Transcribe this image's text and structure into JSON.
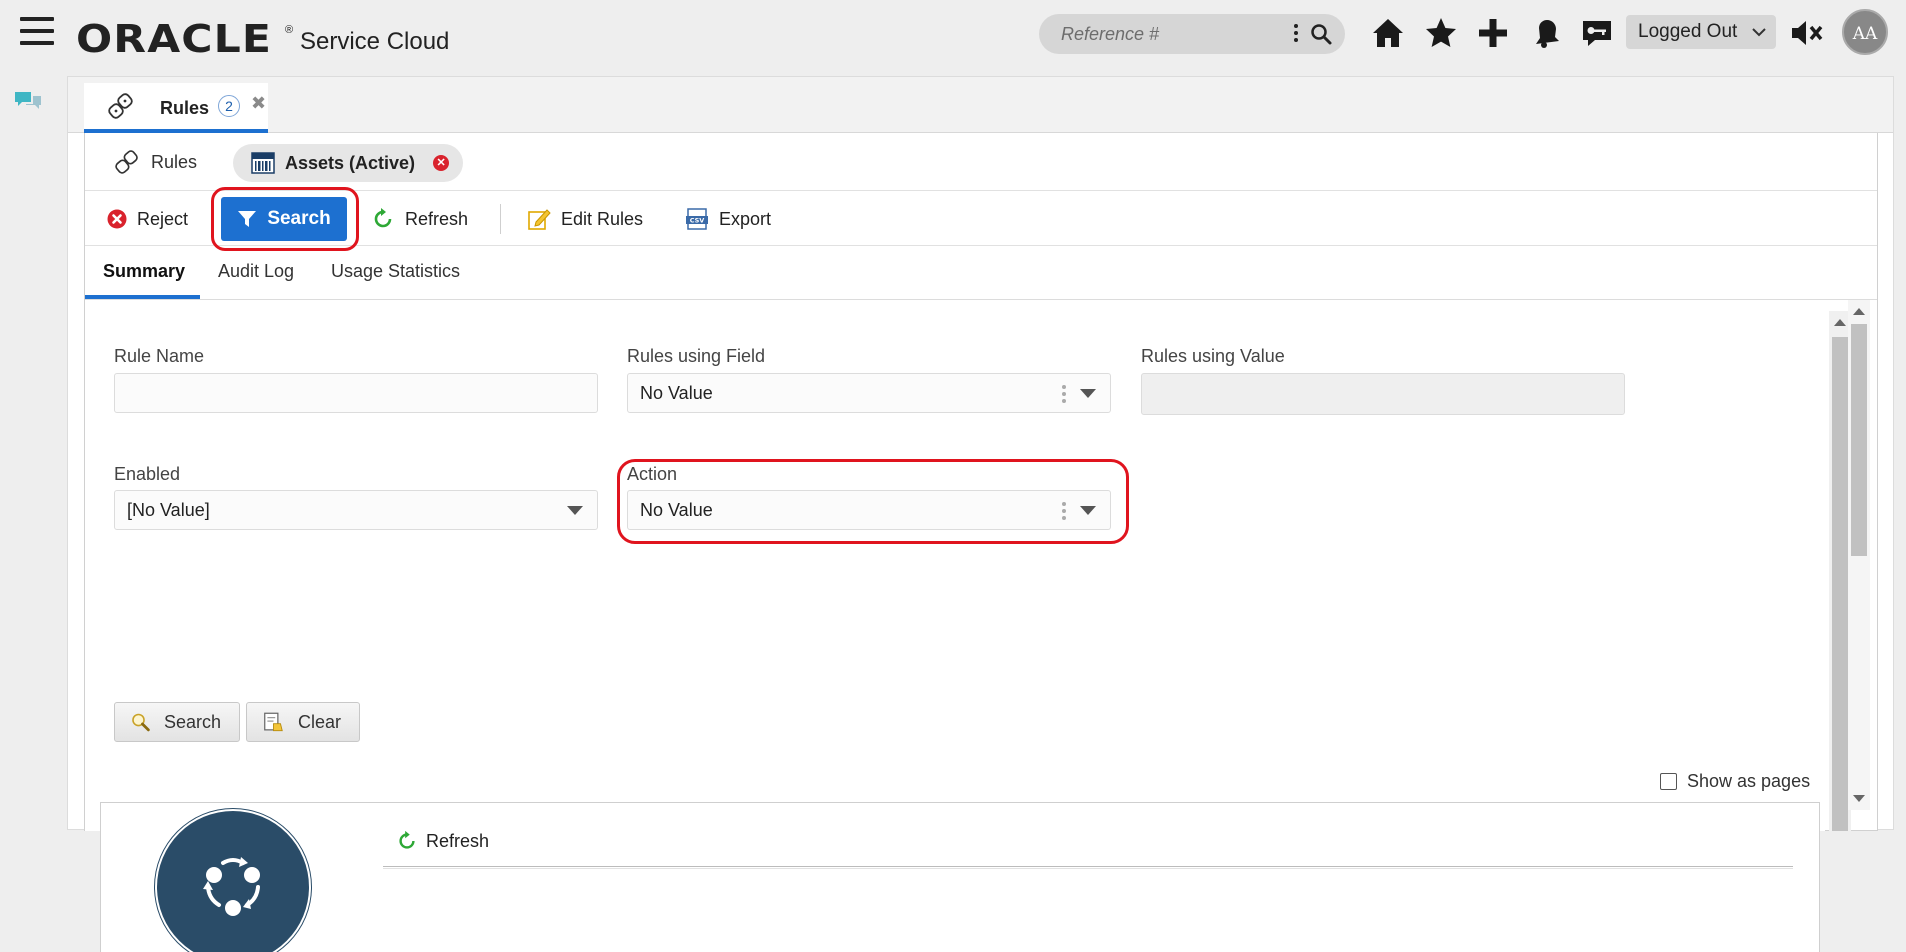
{
  "header": {
    "brand": "ORACLE",
    "brand_mark": "®",
    "product": "Service Cloud",
    "reference_placeholder": "Reference #",
    "status": "Logged Out",
    "avatar_initials": "AA",
    "icons": [
      "menu-icon",
      "home-icon",
      "star-icon",
      "plus-icon",
      "notifications-icon",
      "chat-key-icon",
      "mute-icon"
    ]
  },
  "main_tab": {
    "label": "Rules",
    "count": "2",
    "close": "✖"
  },
  "subtabs": {
    "rules_label": "Rules",
    "assets_label": "Assets (Active)",
    "close": "✕"
  },
  "toolbar": {
    "reject": "Reject",
    "search": "Search",
    "refresh": "Refresh",
    "edit_rules": "Edit Rules",
    "export": "Export"
  },
  "inner_tabs": {
    "summary": "Summary",
    "audit_log": "Audit Log",
    "usage_statistics": "Usage Statistics"
  },
  "form": {
    "rule_name_label": "Rule Name",
    "rule_name_value": "",
    "rules_using_field_label": "Rules using Field",
    "rules_using_field_value": "No Value",
    "rules_using_value_label": "Rules using Value",
    "rules_using_value_value": "",
    "enabled_label": "Enabled",
    "enabled_value": "[No Value]",
    "action_label": "Action",
    "action_value": "No Value",
    "search_button": "Search",
    "clear_button": "Clear",
    "show_as_pages": "Show as pages"
  },
  "results": {
    "refresh": "Refresh"
  },
  "colors": {
    "accent": "#1d70d0",
    "highlight": "#e0141e",
    "reject": "#d9232d",
    "refresh_green": "#2ea836",
    "loader": "#2a4c68"
  }
}
